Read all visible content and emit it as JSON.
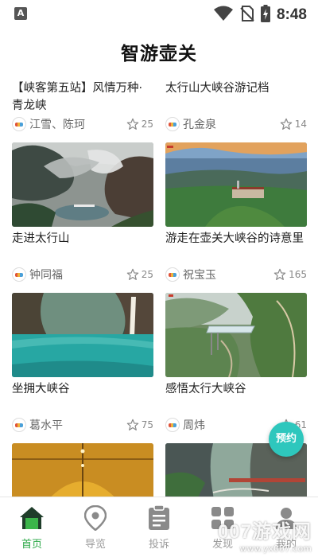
{
  "status_bar": {
    "time": "8:48",
    "notification_icon_letter": "A"
  },
  "app_title": "智游壶关",
  "feed": {
    "cards": [
      {
        "title": "【峡客第五站】风情万种·青龙峡",
        "author": "江雪、陈珂",
        "likes": "25",
        "image": "top-cut"
      },
      {
        "title": "太行山大峡谷游记档",
        "author": "孔金泉",
        "likes": "14",
        "image": "top-cut"
      },
      {
        "title": "走进太行山",
        "author": "钟同福",
        "likes": "25",
        "image": "misty-canyon-lake"
      },
      {
        "title": "游走在壶关大峡谷的诗意里",
        "author": "祝宝玉",
        "likes": "165",
        "image": "canyon-village-sunset"
      },
      {
        "title": "坐拥大峡谷",
        "author": "葛水平",
        "likes": "75",
        "image": "turquoise-river-gorge"
      },
      {
        "title": "感悟太行大峡谷",
        "author": "周炜",
        "likes": "61",
        "image": "cliff-glass-platform"
      },
      {
        "title": "",
        "author": "",
        "likes": "",
        "image": "golden-tunnel"
      },
      {
        "title": "",
        "author": "",
        "likes": "",
        "image": "cliff-water-walkway"
      }
    ]
  },
  "fab": {
    "label": "预约"
  },
  "bottom_nav": {
    "items": [
      {
        "label": "首页",
        "icon": "home-icon",
        "active": true
      },
      {
        "label": "导览",
        "icon": "map-pin-icon",
        "active": false
      },
      {
        "label": "投诉",
        "icon": "clipboard-icon",
        "active": false
      },
      {
        "label": "发现",
        "icon": "grid-icon",
        "active": false
      },
      {
        "label": "我的",
        "icon": "user-icon",
        "active": false
      }
    ]
  },
  "watermark": {
    "text": "007游戏网",
    "url": "www.yx007.com"
  },
  "colors": {
    "accent": "#2aa846",
    "fab": "#2ec7bd",
    "inactive": "#9a9a9a"
  }
}
